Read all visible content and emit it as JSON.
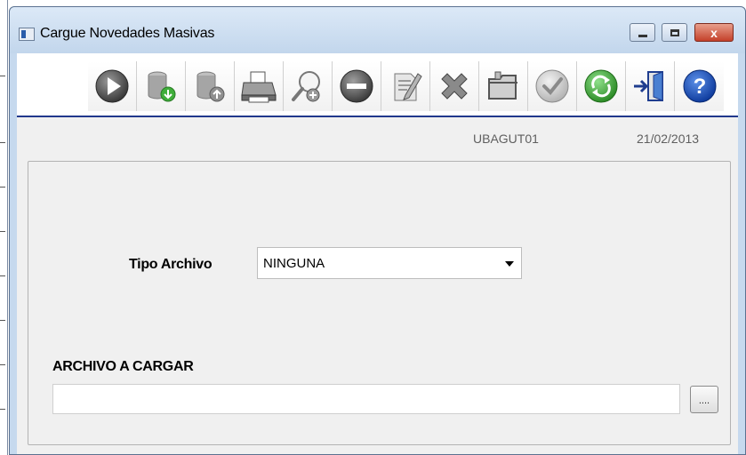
{
  "window": {
    "title": "Cargue Novedades Masivas",
    "close_glyph": "x"
  },
  "toolbar": {
    "buttons": [
      {
        "icon": "play-icon"
      },
      {
        "icon": "database-download-icon"
      },
      {
        "icon": "database-upload-icon"
      },
      {
        "icon": "printer-icon"
      },
      {
        "icon": "search-add-icon"
      },
      {
        "icon": "minus-circle-icon"
      },
      {
        "icon": "edit-document-icon"
      },
      {
        "icon": "delete-x-icon"
      },
      {
        "icon": "folder-icon"
      },
      {
        "icon": "check-circle-icon"
      },
      {
        "icon": "refresh-icon"
      },
      {
        "icon": "exit-door-icon"
      },
      {
        "icon": "help-icon"
      }
    ]
  },
  "status": {
    "user": "UBAGUT01",
    "date": "21/02/2013"
  },
  "form": {
    "tipo_label": "Tipo Archivo",
    "tipo_value": "NINGUNA",
    "archivo_label": "ARCHIVO A CARGAR",
    "archivo_value": "",
    "browse_label": "...."
  },
  "colors": {
    "toolbar_divider": "#21388c",
    "titlebar": "#c6d9ee",
    "client_bg": "#f0f0f0"
  }
}
